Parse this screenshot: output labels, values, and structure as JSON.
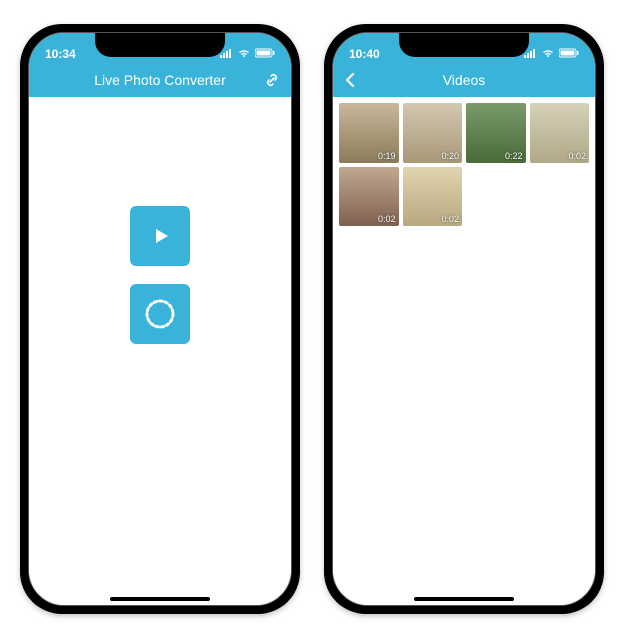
{
  "colors": {
    "accent": "#3ab3da"
  },
  "phone1": {
    "statusTime": "10:34",
    "navTitle": "Live Photo Converter"
  },
  "phone2": {
    "statusTime": "10:40",
    "navTitle": "Videos",
    "videos": [
      {
        "duration": "0:19"
      },
      {
        "duration": "0:20"
      },
      {
        "duration": "0:22"
      },
      {
        "duration": "0:02"
      },
      {
        "duration": "0:02"
      },
      {
        "duration": "0:02"
      }
    ]
  }
}
